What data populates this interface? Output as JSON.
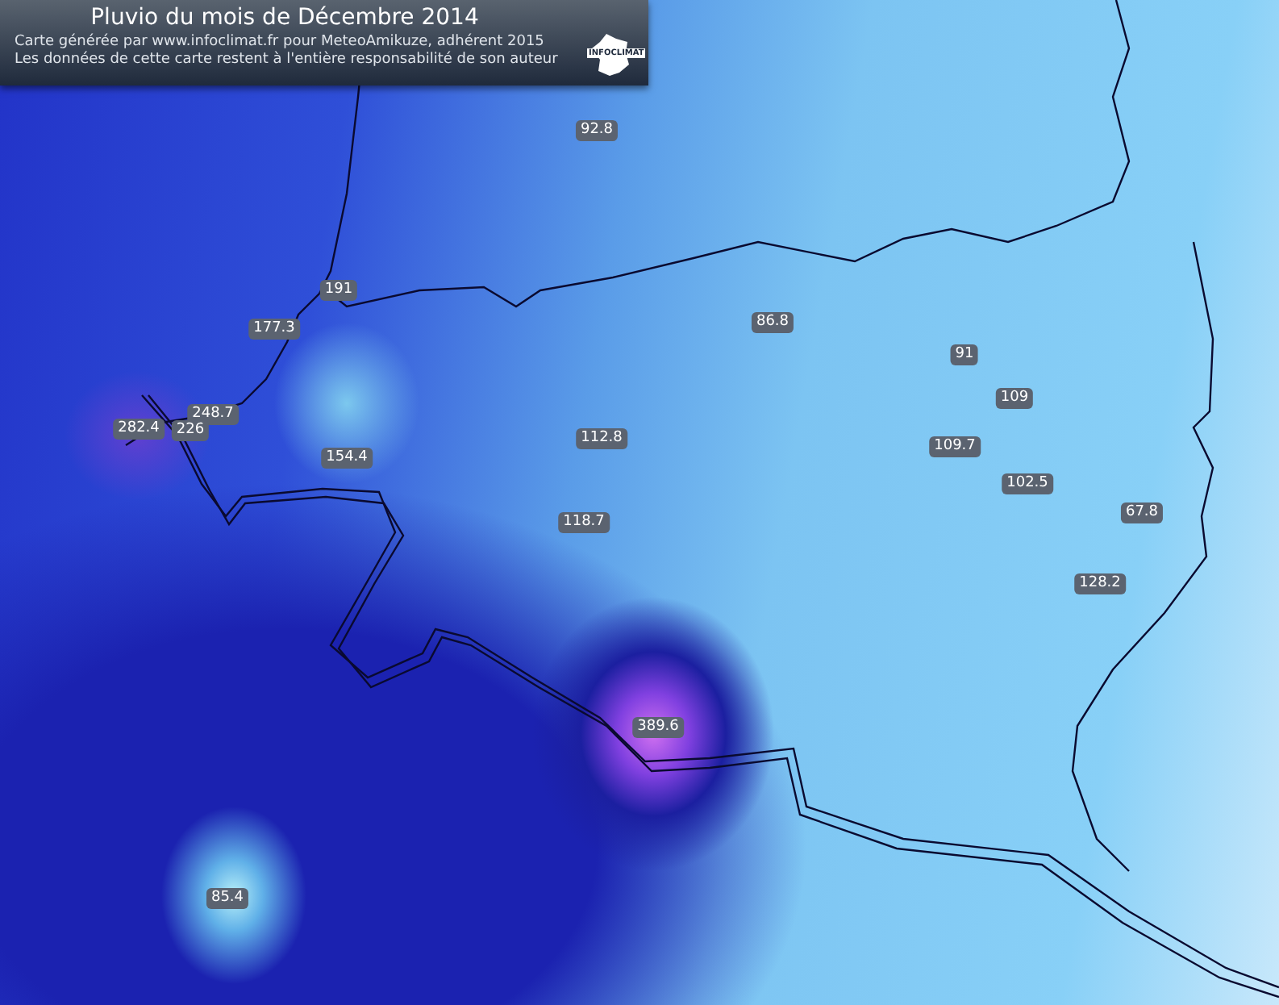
{
  "header": {
    "title": "Pluvio du mois de Décembre 2014",
    "credit_lines": [
      "Carte générée par www.infoclimat.fr pour MeteoAmikuze, adhérent 2015",
      "Les données de cette carte restent à l'entière responsabilité de son auteur"
    ],
    "logo_text": "INFOCLIMAT"
  },
  "stations": [
    {
      "value": "92.8"
    },
    {
      "value": "191"
    },
    {
      "value": "177.3"
    },
    {
      "value": "86.8"
    },
    {
      "value": "91"
    },
    {
      "value": "109"
    },
    {
      "value": "248.7"
    },
    {
      "value": "282.4"
    },
    {
      "value": "226"
    },
    {
      "value": "154.4"
    },
    {
      "value": "112.8"
    },
    {
      "value": "109.7"
    },
    {
      "value": "102.5"
    },
    {
      "value": "118.7"
    },
    {
      "value": "67.8"
    },
    {
      "value": "128.2"
    },
    {
      "value": "389.6"
    },
    {
      "value": "85.4"
    }
  ]
}
